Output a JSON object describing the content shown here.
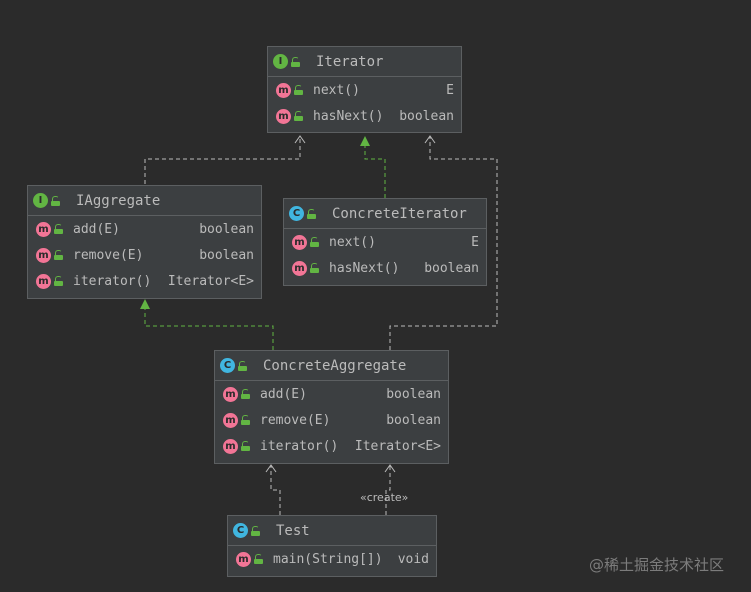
{
  "nodes": {
    "iterator": {
      "kind": "I",
      "name": "Iterator",
      "members": [
        {
          "kind": "m",
          "name": "next()",
          "type": "E"
        },
        {
          "kind": "m",
          "name": "hasNext()",
          "type": "boolean"
        }
      ]
    },
    "iaggregate": {
      "kind": "I",
      "name": "IAggregate",
      "members": [
        {
          "kind": "m",
          "name": "add(E)",
          "type": "boolean"
        },
        {
          "kind": "m",
          "name": "remove(E)",
          "type": "boolean"
        },
        {
          "kind": "m",
          "name": "iterator()",
          "type": "Iterator<E>"
        }
      ]
    },
    "concrete_iterator": {
      "kind": "C",
      "name": "ConcreteIterator",
      "members": [
        {
          "kind": "m",
          "name": "next()",
          "type": "E"
        },
        {
          "kind": "m",
          "name": "hasNext()",
          "type": "boolean"
        }
      ]
    },
    "concrete_aggregate": {
      "kind": "C",
      "name": "ConcreteAggregate",
      "members": [
        {
          "kind": "m",
          "name": "add(E)",
          "type": "boolean"
        },
        {
          "kind": "m",
          "name": "remove(E)",
          "type": "boolean"
        },
        {
          "kind": "m",
          "name": "iterator()",
          "type": "Iterator<E>"
        }
      ]
    },
    "test": {
      "kind": "C",
      "name": "Test",
      "members": [
        {
          "kind": "m",
          "name": "main(String[])",
          "type": "void"
        }
      ]
    }
  },
  "edges": {
    "create_label": "«create»"
  },
  "colors": {
    "background": "#2b2b2b",
    "box": "#3c3f41",
    "realization": "#62b543",
    "dependency": "#bbbbbb"
  },
  "watermark": "@稀土掘金技术社区"
}
